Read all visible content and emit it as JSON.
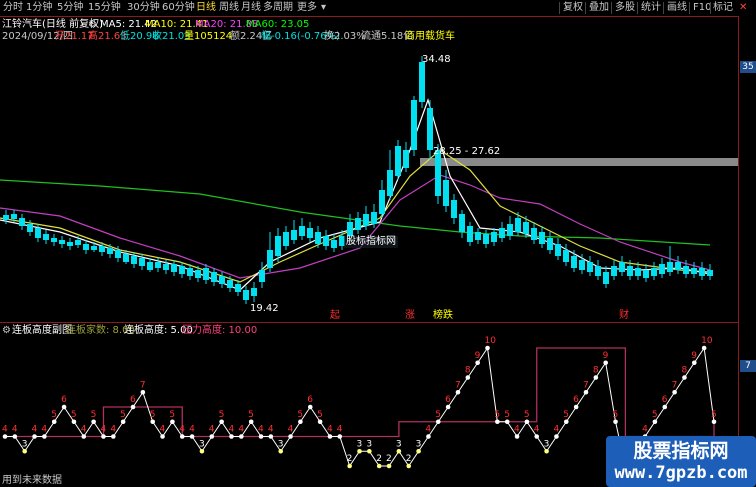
{
  "toolbar": {
    "timeframes": [
      "分时",
      "1分钟",
      "5分钟",
      "15分钟",
      "30分钟",
      "60分钟",
      "日线",
      "周线",
      "月线",
      "多周期",
      "更多"
    ],
    "active_timeframe": "日线",
    "buttons": [
      "复权",
      "叠加",
      "多股",
      "统计",
      "画线",
      "F10",
      "标记"
    ]
  },
  "header": {
    "title": "江铃汽车(日线 前复权)",
    "ma5": "MA5: 21.42",
    "ma10": "MA10: 21.41",
    "ma20": "MA20: 21.88",
    "ma60": "MA60: 23.05",
    "date": "2024/09/12/四",
    "open": "开21.17",
    "high": "高21.63",
    "low": "低20.98",
    "close": "收21.03",
    "volume": "量105124",
    "amount": "额2.24亿",
    "change": "幅-0.16(-0.76%)",
    "turnover": "换2.03%",
    "float": "流通5.18亿",
    "sector": "商用载货车"
  },
  "main_chart": {
    "price_max_label": "34.48",
    "price_min_label": "19.42",
    "range_label": "28.25 - 27.62",
    "indicator_overlay": "股标指标网",
    "axis_tag": "35",
    "signal_labels": [
      {
        "text": "起",
        "color": "#ff3030"
      },
      {
        "text": "涨",
        "color": "#ff3030"
      },
      {
        "text": "榜跌",
        "color": "#ffff00"
      },
      {
        "text": "财",
        "color": "#ff3030"
      }
    ]
  },
  "sub_chart": {
    "name": "连板高度副图",
    "field1": "连板家数: 8.00",
    "field2": "连板高度: 5.00",
    "field3": "压力高度: 10.00",
    "axis_tag": "7",
    "footer": "用到未来数据",
    "series_colors": {
      "height": "#ffffff",
      "pressure": "#b03060"
    }
  },
  "chart_data": {
    "type": "line",
    "title": "连板高度副图",
    "series": [
      {
        "name": "连板高度",
        "values": [
          4,
          4,
          3,
          4,
          4,
          5,
          6,
          5,
          4,
          5,
          4,
          4,
          5,
          6,
          7,
          5,
          4,
          5,
          4,
          4,
          3,
          4,
          5,
          4,
          4,
          5,
          4,
          4,
          3,
          4,
          5,
          6,
          5,
          4,
          4,
          2,
          3,
          3,
          2,
          2,
          3,
          2,
          3,
          4,
          5,
          6,
          7,
          8,
          9,
          10,
          5,
          5,
          4,
          5,
          4,
          3,
          4,
          5,
          6,
          7,
          8,
          9,
          5,
          2,
          2,
          4,
          5,
          6,
          7,
          8,
          9,
          10,
          5
        ]
      },
      {
        "name": "压力高度",
        "values": [
          4,
          4,
          4,
          4,
          4,
          4,
          4,
          4,
          4,
          4,
          6,
          6,
          6,
          6,
          6,
          6,
          6,
          6,
          4,
          4,
          4,
          4,
          4,
          4,
          4,
          4,
          4,
          4,
          4,
          4,
          4,
          4,
          4,
          4,
          4,
          4,
          4,
          4,
          4,
          4,
          5,
          5,
          5,
          5,
          5,
          5,
          5,
          5,
          5,
          5,
          5,
          5,
          5,
          5,
          10,
          10,
          10,
          10,
          10,
          10,
          10,
          10,
          10,
          4,
          4,
          4,
          4,
          4,
          4,
          4,
          4,
          4,
          5
        ]
      }
    ]
  },
  "watermark": {
    "line1": "股票指标网",
    "line2": "www.7gpzb.com"
  }
}
